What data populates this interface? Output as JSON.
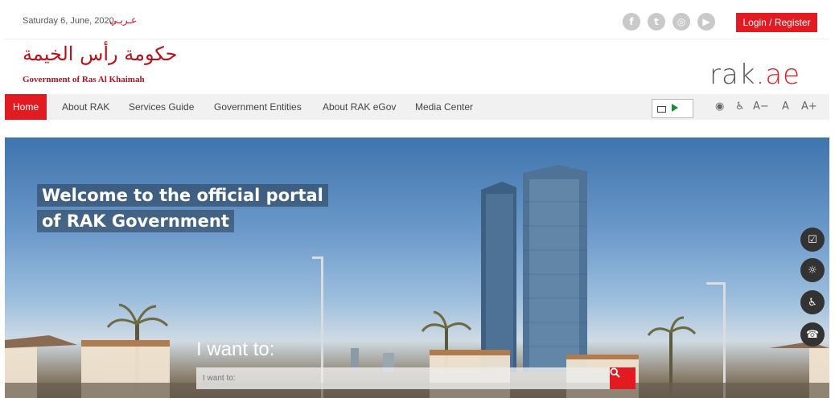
{
  "topbar": {
    "date": "Saturday 6, June, 2020",
    "language_link": "عـربـي",
    "login_label": "Login / Register",
    "socials": [
      {
        "icon": "facebook-icon",
        "glyph": "f"
      },
      {
        "icon": "twitter-icon",
        "glyph": "t"
      },
      {
        "icon": "instagram-icon",
        "glyph": "◎"
      },
      {
        "icon": "youtube-icon",
        "glyph": "▶"
      }
    ]
  },
  "logo": {
    "arabic": "حكومة رأس الخيمة",
    "english": "Government of Ras Al Khaimah",
    "portal_rak": "rak",
    "portal_dot": ".",
    "portal_ae": "ae"
  },
  "nav": {
    "items": [
      {
        "label": "Home",
        "active": true
      },
      {
        "label": "About RAK"
      },
      {
        "label": "Services Guide"
      },
      {
        "label": "Government Entities"
      },
      {
        "label": "About RAK eGov"
      },
      {
        "label": "Media Center"
      }
    ],
    "accessibility": {
      "eye": "◉",
      "person": "♿",
      "decrease": "A−",
      "normal": "A",
      "increase": "A+"
    }
  },
  "hero": {
    "welcome_line1": "Welcome to the official portal",
    "welcome_line2": "of RAK Government",
    "i_want_label": "I want to:",
    "search_placeholder": "I want to:",
    "side_actions": [
      {
        "icon": "survey-icon",
        "glyph": "☑"
      },
      {
        "icon": "weather-icon",
        "glyph": "☼"
      },
      {
        "icon": "accessibility-icon",
        "glyph": "♿"
      },
      {
        "icon": "phone-icon",
        "glyph": "☎"
      }
    ]
  },
  "colors": {
    "brand_red": "#e21b22",
    "logo_red": "#b4131d"
  }
}
